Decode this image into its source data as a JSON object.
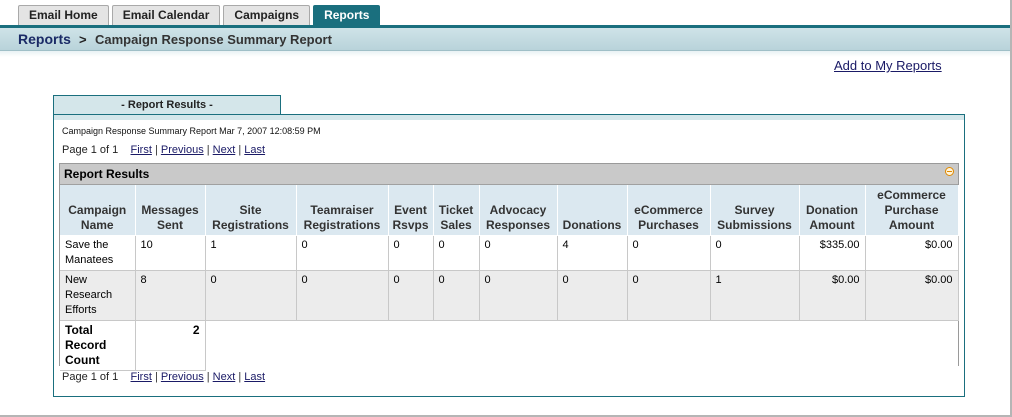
{
  "tabs": [
    {
      "label": "Email Home",
      "active": false
    },
    {
      "label": "Email Calendar",
      "active": false
    },
    {
      "label": "Campaigns",
      "active": false
    },
    {
      "label": "Reports",
      "active": true
    }
  ],
  "breadcrumb": {
    "root": "Reports",
    "separator": ">",
    "title": "Campaign Response Summary Report"
  },
  "add_to_reports_label": "Add to My Reports",
  "panel": {
    "tab_label": "- Report Results -",
    "report_line": "Campaign Response Summary Report Mar 7, 2007 12:08:59 PM",
    "pager": {
      "page_text": "Page 1 of 1",
      "first": "First",
      "previous": "Previous",
      "next": "Next",
      "last": "Last",
      "separator": "|"
    },
    "results": {
      "heading": "Report Results",
      "columns": [
        "Campaign Name",
        "Messages Sent",
        "Site Registrations",
        "Teamraiser Registrations",
        "Event Rsvps",
        "Ticket Sales",
        "Advocacy Responses",
        "Donations",
        "eCommerce Purchases",
        "Survey Submissions",
        "Donation Amount",
        "eCommerce Purchase Amount"
      ],
      "rows": [
        [
          "Save the Manatees",
          "10",
          "1",
          "0",
          "0",
          "0",
          "0",
          "4",
          "0",
          "0",
          "$335.00",
          "$0.00"
        ],
        [
          "New Research Efforts",
          "8",
          "0",
          "0",
          "0",
          "0",
          "0",
          "0",
          "0",
          "1",
          "$0.00",
          "$0.00"
        ]
      ],
      "total_label": "Total Record Count",
      "total_value": "2"
    }
  },
  "colors": {
    "accent": "#1a6f7e",
    "header_bg": "#dbe8f0",
    "link": "#1a1a66"
  }
}
